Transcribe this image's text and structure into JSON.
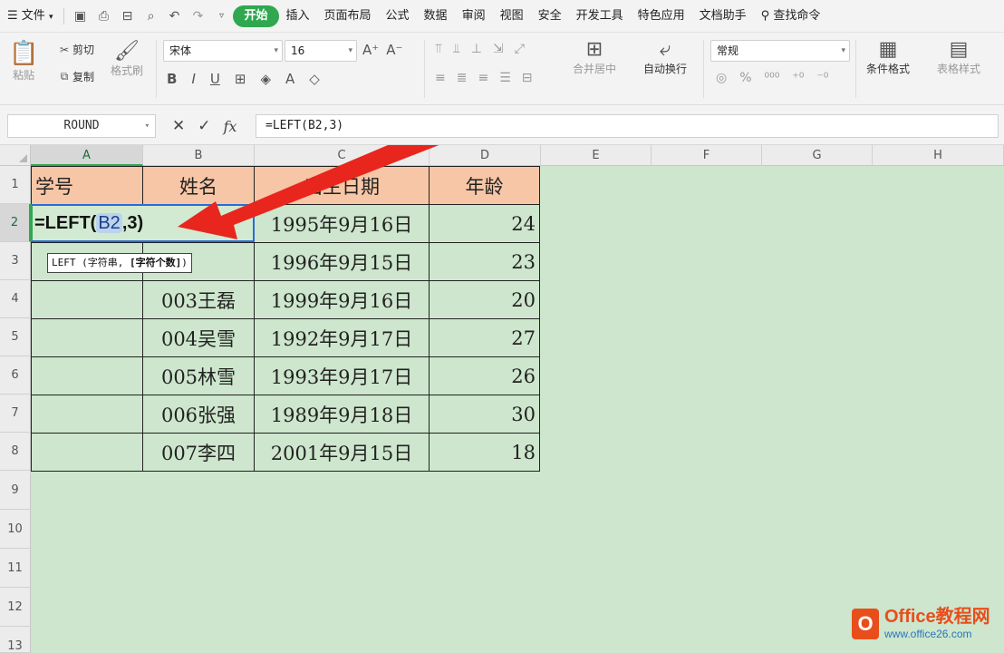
{
  "menubar": {
    "file": "文件",
    "tabs": [
      "开始",
      "插入",
      "页面布局",
      "公式",
      "数据",
      "审阅",
      "视图",
      "安全",
      "开发工具",
      "特色应用",
      "文档助手"
    ],
    "active_tab": "开始",
    "search": "查找命令"
  },
  "ribbon": {
    "paste": "粘贴",
    "cut": "剪切",
    "copy": "复制",
    "format_painter": "格式刷",
    "font_name": "宋体",
    "font_size": "16",
    "merge_center": "合并居中",
    "wrap_text": "自动换行",
    "number_format": "常规",
    "conditional_format": "条件格式",
    "table_style": "表格样式"
  },
  "formula_bar": {
    "name_box": "ROUND",
    "fx": "fx",
    "formula": "=LEFT(B2,3)"
  },
  "grid": {
    "columns": [
      "A",
      "B",
      "C",
      "D",
      "E",
      "F",
      "G",
      "H"
    ],
    "active_column": "A",
    "rows": [
      "1",
      "2",
      "3",
      "4",
      "5",
      "6",
      "7",
      "8",
      "9",
      "10",
      "11",
      "12",
      "13"
    ],
    "active_row": "2",
    "header": [
      "学号",
      "姓名",
      "出生日期",
      "年龄"
    ],
    "data": [
      {
        "a": "",
        "b": "",
        "c": "1995年9月16日",
        "d": "24"
      },
      {
        "a": "",
        "b": "",
        "c": "1996年9月15日",
        "d": "23"
      },
      {
        "a": "",
        "b": "003王磊",
        "c": "1999年9月16日",
        "d": "20"
      },
      {
        "a": "",
        "b": "004吴雪",
        "c": "1992年9月17日",
        "d": "27"
      },
      {
        "a": "",
        "b": "005林雪",
        "c": "1993年9月17日",
        "d": "26"
      },
      {
        "a": "",
        "b": "006张强",
        "c": "1989年9月18日",
        "d": "30"
      },
      {
        "a": "",
        "b": "007李四",
        "c": "2001年9月15日",
        "d": "18"
      }
    ],
    "edit_cell": {
      "prefix": "=LEFT(",
      "ref": "B2",
      "suffix": ",3)"
    },
    "tooltip": {
      "main": "LEFT (字符串, ",
      "arg": "[字符个数]",
      "end": ")"
    }
  },
  "watermark": {
    "brand": "Office教程网",
    "url": "www.office26.com"
  },
  "colors": {
    "accent": "#2fa84f",
    "header_fill": "#f7c6a6",
    "sheet_bg": "#cde6cd",
    "arrow": "#e8261d"
  }
}
